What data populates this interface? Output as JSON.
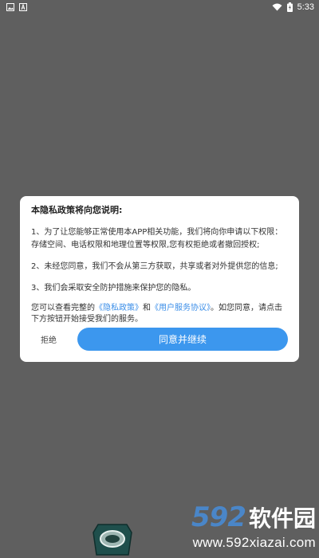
{
  "status_bar": {
    "time": "5:33",
    "left_icons": [
      "image-icon",
      "text-a-icon"
    ],
    "right_icons": [
      "wifi-icon",
      "battery-icon"
    ]
  },
  "dialog": {
    "title": "本隐私政策将向您说明:",
    "para1": "1、为了让您能够正常使用本APP相关功能，我们将向你申请以下权限：存储空间、电话权限和地理位置等权限,您有权拒绝或者撤回授权;",
    "para2": "2、未经您同意，我们不会从第三方获取，共享或者对外提供您的信息;",
    "para3": "3、我们会采取安全防护措施来保护您的隐私。",
    "para4_prefix": "您可以查看完整的",
    "privacy_link": "《隐私政策》",
    "and_text": "和",
    "agreement_link": "《用户服务协议》",
    "para4_suffix": "。如您同意，请点击下方按钮开始接受我们的服务。",
    "reject_label": "拒绝",
    "agree_label": "同意并继续"
  },
  "watermark": {
    "number": "592",
    "name": "软件园",
    "url": "www.592xiazai.com"
  },
  "colors": {
    "overlay": "#5f5f5f",
    "accent": "#3c97ee",
    "link": "#3b8ee8",
    "watermark_blue": "#4a86c8"
  }
}
